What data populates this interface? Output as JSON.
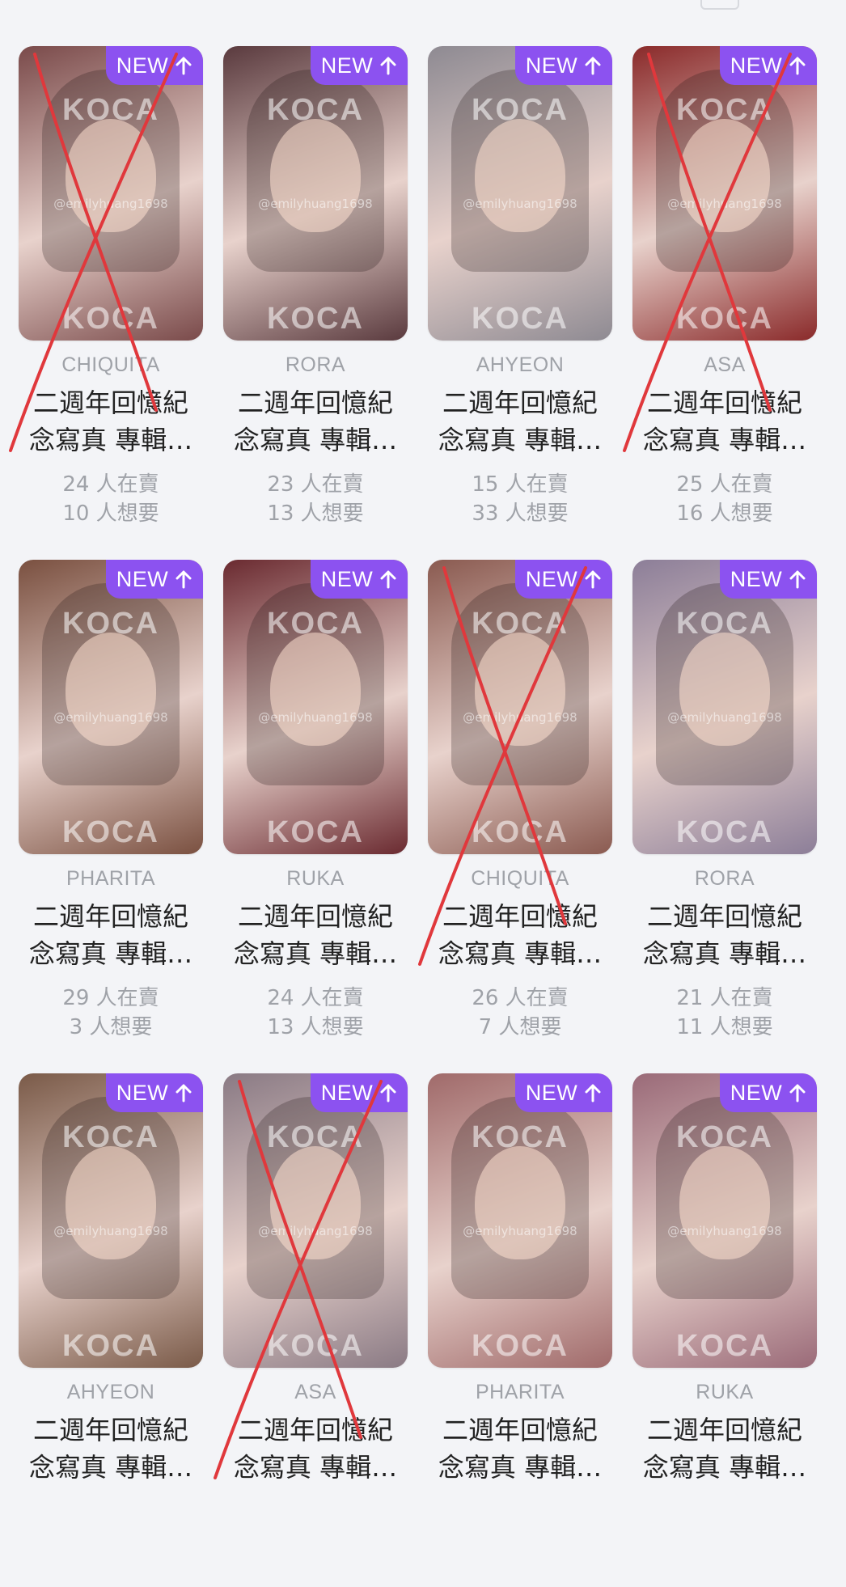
{
  "badge_label": "NEW",
  "badge_icon": "arrow-up-icon",
  "brand_watermark": "KOCA",
  "handle_watermark": "@emilyhuang1698",
  "accent_color": "#8c52f0",
  "cross_color": "#e0383c",
  "cards": [
    {
      "member": "CHIQUITA",
      "title_1": "二週年回憶紀",
      "title_2": "念寫真 專輯…",
      "selling": "24 人在賣",
      "wanting": "10 人想要",
      "crossed": true,
      "tone": "#7a4a4a"
    },
    {
      "member": "RORA",
      "title_1": "二週年回憶紀",
      "title_2": "念寫真 專輯…",
      "selling": "23 人在賣",
      "wanting": "13 人想要",
      "crossed": false,
      "tone": "#5a3a3e"
    },
    {
      "member": "AHYEON",
      "title_1": "二週年回憶紀",
      "title_2": "念寫真 專輯…",
      "selling": "15 人在賣",
      "wanting": "33 人想要",
      "crossed": false,
      "tone": "#8e8a92"
    },
    {
      "member": "ASA",
      "title_1": "二週年回憶紀",
      "title_2": "念寫真 專輯…",
      "selling": "25 人在賣",
      "wanting": "16 人想要",
      "crossed": true,
      "tone": "#8a2a2a"
    },
    {
      "member": "PHARITA",
      "title_1": "二週年回憶紀",
      "title_2": "念寫真 專輯…",
      "selling": "29 人在賣",
      "wanting": "3 人想要",
      "crossed": false,
      "tone": "#7a5040"
    },
    {
      "member": "RUKA",
      "title_1": "二週年回憶紀",
      "title_2": "念寫真 專輯…",
      "selling": "24 人在賣",
      "wanting": "13 人想要",
      "crossed": false,
      "tone": "#6a2a30"
    },
    {
      "member": "CHIQUITA",
      "title_1": "二週年回憶紀",
      "title_2": "念寫真 專輯…",
      "selling": "26 人在賣",
      "wanting": "7 人想要",
      "crossed": true,
      "tone": "#8a5a50"
    },
    {
      "member": "RORA",
      "title_1": "二週年回憶紀",
      "title_2": "念寫真 專輯…",
      "selling": "21 人在賣",
      "wanting": "11 人想要",
      "crossed": false,
      "tone": "#8c7e98"
    },
    {
      "member": "AHYEON",
      "title_1": "二週年回憶紀",
      "title_2": "念寫真 專輯…",
      "selling": "",
      "wanting": "",
      "crossed": false,
      "tone": "#7a5a48"
    },
    {
      "member": "ASA",
      "title_1": "二週年回憶紀",
      "title_2": "念寫真 專輯…",
      "selling": "",
      "wanting": "",
      "crossed": true,
      "tone": "#8a7a84"
    },
    {
      "member": "PHARITA",
      "title_1": "二週年回憶紀",
      "title_2": "念寫真 專輯…",
      "selling": "",
      "wanting": "",
      "crossed": false,
      "tone": "#a06a6a"
    },
    {
      "member": "RUKA",
      "title_1": "二週年回憶紀",
      "title_2": "念寫真 專輯…",
      "selling": "",
      "wanting": "",
      "crossed": false,
      "tone": "#9a6a78"
    }
  ]
}
